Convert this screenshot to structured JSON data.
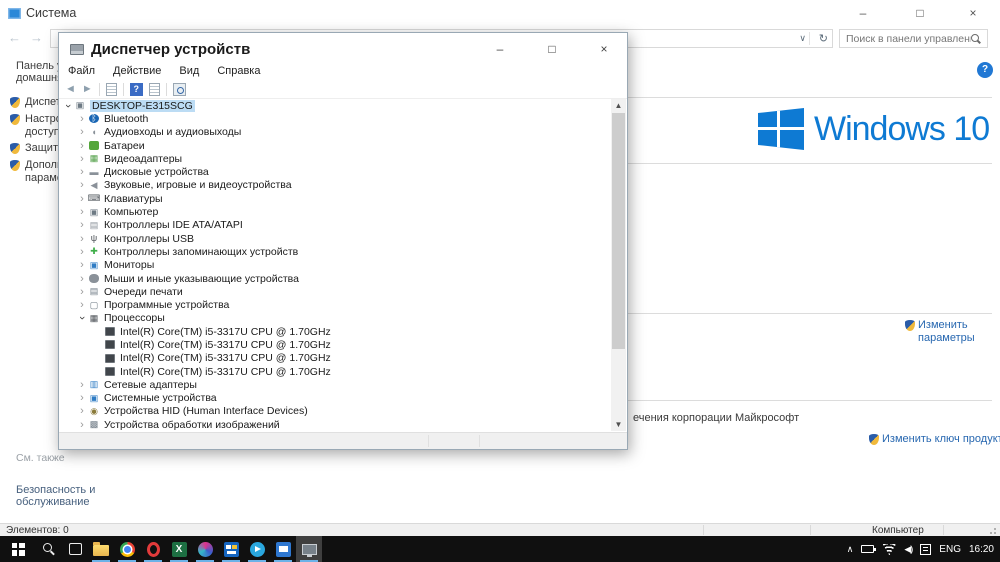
{
  "colors": {
    "win_blue": "#0e7ad3",
    "link_blue": "#2767b0",
    "selection_bg": "#bcdcf4",
    "taskbar_bg": "#101010"
  },
  "icons": {
    "minimize": "–",
    "maximize": "□",
    "close": "×",
    "back": "←",
    "forward": "→",
    "refresh": "↻",
    "chevron_down": "∨",
    "help": "?",
    "tray_chevron": "∧"
  },
  "system_window": {
    "title": "Система",
    "nav": {
      "search_placeholder": "Поиск в панели управления"
    },
    "sidebar": {
      "home": "Панель управления — домашняя страница",
      "items": [
        "Диспетчер устройств",
        "Настройка удаленного доступа",
        "Защита системы",
        "Дополнительные параметры системы"
      ],
      "see_also": "См. также",
      "see_also_link": "Безопасность и обслуживание"
    },
    "main": {
      "logo_text": "Windows 10",
      "change_settings": "Изменить параметры",
      "license_fragment": "ечения корпорации Майкрософт",
      "change_product_key": "Изменить ключ продукта"
    },
    "statusbar": {
      "items_count": "Элементов: 0",
      "computer": "Компьютер"
    }
  },
  "device_manager": {
    "title": "Диспетчер устройств",
    "menu": [
      "Файл",
      "Действие",
      "Вид",
      "Справка"
    ],
    "tree": [
      {
        "label": "DESKTOP-E315SCG",
        "icon": "computer",
        "level": 0,
        "state": "expanded",
        "selected": true
      },
      {
        "label": "Bluetooth",
        "icon": "bluetooth",
        "level": 1,
        "state": "collapsed"
      },
      {
        "label": "Аудиовходы и аудиовыходы",
        "icon": "audio-inputs",
        "level": 1,
        "state": "collapsed"
      },
      {
        "label": "Батареи",
        "icon": "battery",
        "level": 1,
        "state": "collapsed"
      },
      {
        "label": "Видеоадаптеры",
        "icon": "display-adapter",
        "level": 1,
        "state": "collapsed"
      },
      {
        "label": "Дисковые устройства",
        "icon": "disk-drive",
        "level": 1,
        "state": "collapsed"
      },
      {
        "label": "Звуковые, игровые и видеоустройства",
        "icon": "sound",
        "level": 1,
        "state": "collapsed"
      },
      {
        "label": "Клавиатуры",
        "icon": "keyboard",
        "level": 1,
        "state": "collapsed"
      },
      {
        "label": "Компьютер",
        "icon": "computer",
        "level": 1,
        "state": "collapsed"
      },
      {
        "label": "Контроллеры IDE ATA/ATAPI",
        "icon": "ide-controller",
        "level": 1,
        "state": "collapsed"
      },
      {
        "label": "Контроллеры USB",
        "icon": "usb-controller",
        "level": 1,
        "state": "collapsed"
      },
      {
        "label": "Контроллеры запоминающих устройств",
        "icon": "storage-controller",
        "level": 1,
        "state": "collapsed"
      },
      {
        "label": "Мониторы",
        "icon": "monitor",
        "level": 1,
        "state": "collapsed"
      },
      {
        "label": "Мыши и иные указывающие устройства",
        "icon": "mouse",
        "level": 1,
        "state": "collapsed"
      },
      {
        "label": "Очереди печати",
        "icon": "printer",
        "level": 1,
        "state": "collapsed"
      },
      {
        "label": "Программные устройства",
        "icon": "software-device",
        "level": 1,
        "state": "collapsed"
      },
      {
        "label": "Процессоры",
        "icon": "processor",
        "level": 1,
        "state": "expanded"
      },
      {
        "label": "Intel(R) Core(TM) i5-3317U CPU @ 1.70GHz",
        "icon": "cpu-chip",
        "level": 2,
        "state": "leaf"
      },
      {
        "label": "Intel(R) Core(TM) i5-3317U CPU @ 1.70GHz",
        "icon": "cpu-chip",
        "level": 2,
        "state": "leaf"
      },
      {
        "label": "Intel(R) Core(TM) i5-3317U CPU @ 1.70GHz",
        "icon": "cpu-chip",
        "level": 2,
        "state": "leaf"
      },
      {
        "label": "Intel(R) Core(TM) i5-3317U CPU @ 1.70GHz",
        "icon": "cpu-chip",
        "level": 2,
        "state": "leaf"
      },
      {
        "label": "Сетевые адаптеры",
        "icon": "network-adapter",
        "level": 1,
        "state": "collapsed"
      },
      {
        "label": "Системные устройства",
        "icon": "system-device",
        "level": 1,
        "state": "collapsed"
      },
      {
        "label": "Устройства HID (Human Interface Devices)",
        "icon": "hid-device",
        "level": 1,
        "state": "collapsed"
      },
      {
        "label": "Устройства обработки изображений",
        "icon": "imaging-device",
        "level": 1,
        "state": "collapsed"
      }
    ]
  },
  "taskbar": {
    "apps": [
      {
        "name": "start"
      },
      {
        "name": "search"
      },
      {
        "name": "task-view"
      },
      {
        "name": "file-explorer",
        "running": true
      },
      {
        "name": "chrome",
        "running": true
      },
      {
        "name": "opera",
        "running": true
      },
      {
        "name": "excel",
        "running": true
      },
      {
        "name": "photo-app",
        "running": true
      },
      {
        "name": "store-app",
        "running": true
      },
      {
        "name": "telegram",
        "running": true
      },
      {
        "name": "movies-app",
        "running": true
      },
      {
        "name": "device-manager",
        "running": true,
        "active": true
      }
    ],
    "tray": {
      "language": "ENG",
      "time": "16:20"
    }
  }
}
